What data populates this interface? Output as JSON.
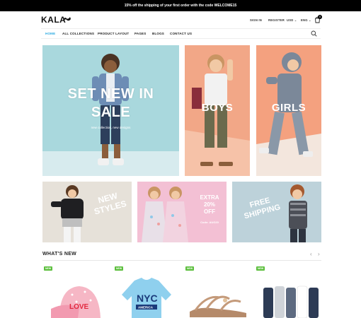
{
  "promo": {
    "text": "15% off the shipping of your first order with the code WELCOME15"
  },
  "header": {
    "logo": "KALA",
    "sign_in": "SIGN IN",
    "register": "REGISTER",
    "currency": "USD ⌄",
    "language": "ENG ⌄",
    "cart_count": "0"
  },
  "nav": {
    "items": [
      "HOME",
      "ALL COLLECTIONS",
      "PRODUCT LAYOUT",
      "PAGES",
      "BLOGS",
      "CONTACT US"
    ]
  },
  "banners": {
    "main": {
      "title_line1": "SET NEW IN",
      "title_line2": "SALE",
      "subtitle": "new collection, new designs"
    },
    "boys": {
      "title": "BOYS"
    },
    "girls": {
      "title": "GIRLS"
    },
    "new_styles": {
      "line1": "NEW",
      "line2": "STYLES"
    },
    "extra": {
      "line1": "EXTRA",
      "line2": "20%",
      "line3": "OFF",
      "code": "Code: AUG20"
    },
    "free": {
      "line1": "FREE",
      "line2": "SHIPPING"
    }
  },
  "whats_new": {
    "title": "WHAT'S NEW",
    "prev": "‹",
    "next": "›",
    "products": [
      {
        "badge": "NEW",
        "print": "LOVE"
      },
      {
        "badge": "NEW",
        "print_line1": "NYC",
        "print_line2": "AMERICA"
      },
      {
        "badge": "NEW"
      },
      {
        "badge": "NEW"
      }
    ]
  },
  "colors": {
    "accent": "#29a9e1",
    "badge": "#5cbf3d",
    "promo_bg": "#000000"
  }
}
